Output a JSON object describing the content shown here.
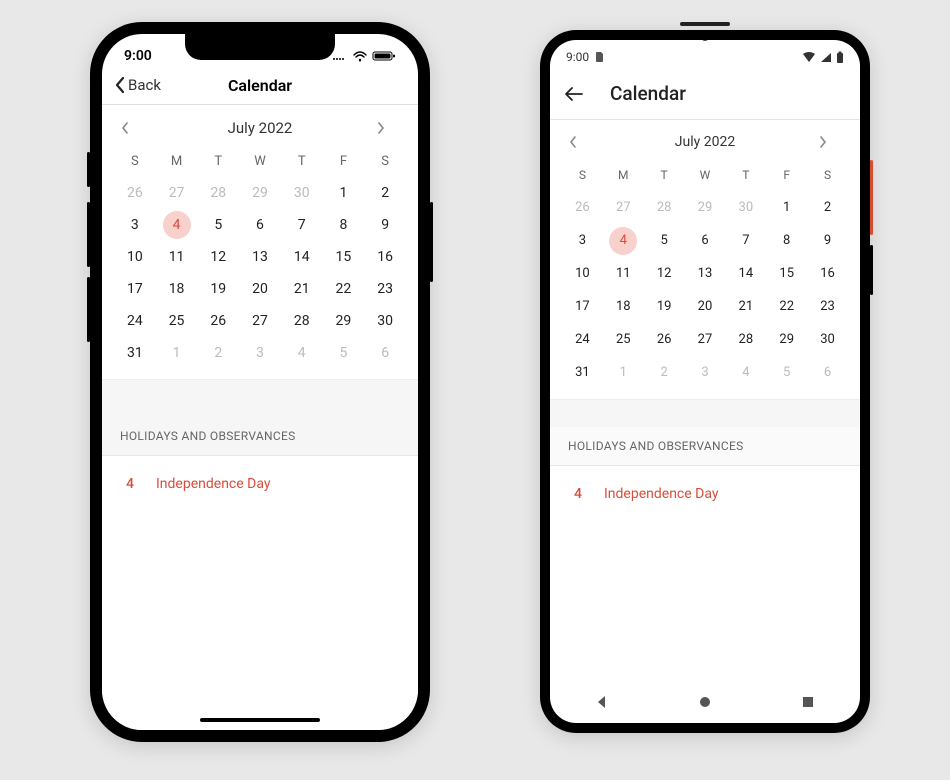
{
  "status": {
    "time": "9:00"
  },
  "ios": {
    "back_label": "Back",
    "title": "Calendar"
  },
  "android": {
    "title": "Calendar"
  },
  "calendar": {
    "month_label": "July 2022",
    "weekdays": [
      "S",
      "M",
      "T",
      "W",
      "T",
      "F",
      "S"
    ],
    "weeks": [
      [
        {
          "n": 26,
          "out": true
        },
        {
          "n": 27,
          "out": true
        },
        {
          "n": 28,
          "out": true
        },
        {
          "n": 29,
          "out": true
        },
        {
          "n": 30,
          "out": true
        },
        {
          "n": 1
        },
        {
          "n": 2
        }
      ],
      [
        {
          "n": 3
        },
        {
          "n": 4,
          "selected": true
        },
        {
          "n": 5
        },
        {
          "n": 6
        },
        {
          "n": 7
        },
        {
          "n": 8
        },
        {
          "n": 9
        }
      ],
      [
        {
          "n": 10
        },
        {
          "n": 11
        },
        {
          "n": 12
        },
        {
          "n": 13
        },
        {
          "n": 14
        },
        {
          "n": 15
        },
        {
          "n": 16
        }
      ],
      [
        {
          "n": 17
        },
        {
          "n": 18
        },
        {
          "n": 19
        },
        {
          "n": 20
        },
        {
          "n": 21
        },
        {
          "n": 22
        },
        {
          "n": 23
        }
      ],
      [
        {
          "n": 24
        },
        {
          "n": 25
        },
        {
          "n": 26
        },
        {
          "n": 27
        },
        {
          "n": 28
        },
        {
          "n": 29
        },
        {
          "n": 30
        }
      ],
      [
        {
          "n": 31
        },
        {
          "n": 1,
          "out": true
        },
        {
          "n": 2,
          "out": true
        },
        {
          "n": 3,
          "out": true
        },
        {
          "n": 4,
          "out": true
        },
        {
          "n": 5,
          "out": true
        },
        {
          "n": 6,
          "out": true
        }
      ]
    ]
  },
  "holidays": {
    "header": "HOLIDAYS AND OBSERVANCES",
    "items": [
      {
        "day": "4",
        "name": "Independence Day"
      }
    ]
  },
  "colors": {
    "accent": "#d84d3a"
  }
}
